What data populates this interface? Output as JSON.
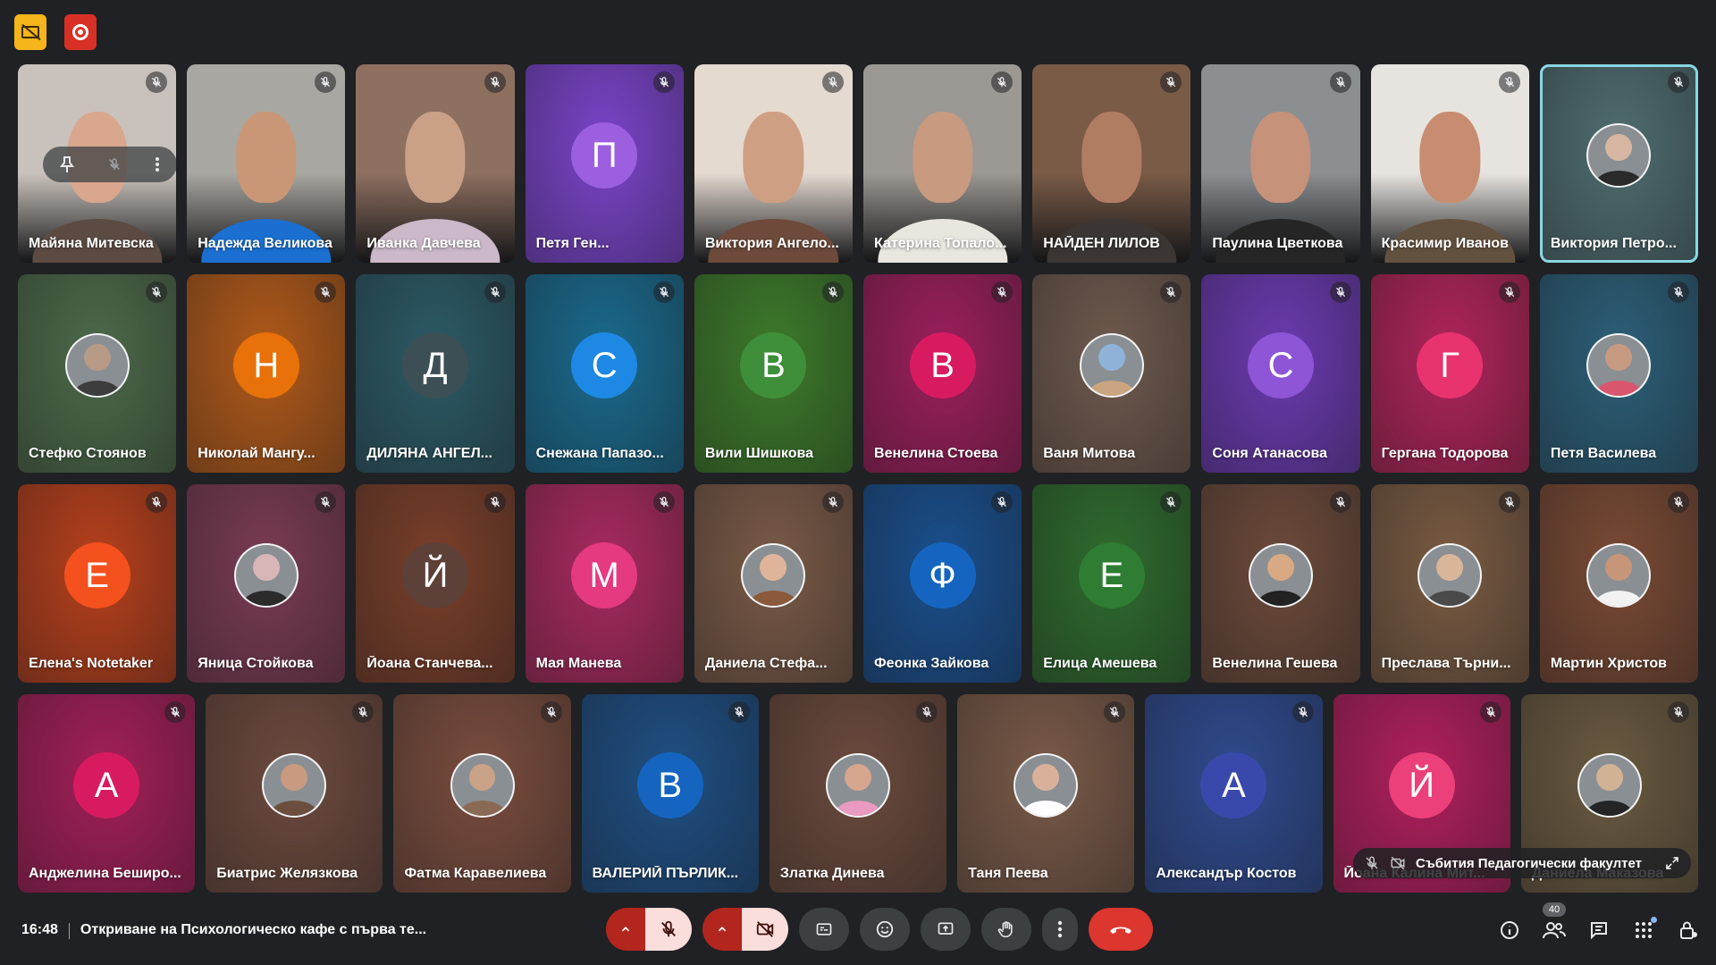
{
  "rows": [
    {
      "tiles": [
        {
          "name": "Майяна Митевска",
          "type": "video",
          "bg": "#c9c2bc",
          "skin": "#d9a78e",
          "shirt": "#5c4b43",
          "controls": true
        },
        {
          "name": "Надежда Великова",
          "type": "video",
          "bg": "#a9a7a1",
          "skin": "#c99676",
          "shirt": "#1b6fd0"
        },
        {
          "name": "Иванка Давчева",
          "type": "video",
          "bg": "#8e7060",
          "skin": "#caa187",
          "shirt": "#cbb9c9"
        },
        {
          "name": "Петя Ген...",
          "type": "letter",
          "letter": "П",
          "bg": "#7a44c9",
          "avatar": "#9c5fe0"
        },
        {
          "name": "Виктория Ангело...",
          "type": "video",
          "bg": "#e4dad0",
          "skin": "#cf9f84",
          "shirt": "#6d4a3a"
        },
        {
          "name": "Катерина Топало...",
          "type": "video",
          "bg": "#9c9893",
          "skin": "#c89a80",
          "shirt": "#e9e5df"
        },
        {
          "name": "НАЙДЕН ЛИЛОВ",
          "type": "video",
          "bg": "#7a5b46",
          "skin": "#b07d63",
          "shirt": "#3b3633"
        },
        {
          "name": "Паулина Цветкова",
          "type": "video",
          "bg": "#8b8f92",
          "skin": "#c69279",
          "shirt": "#252525"
        },
        {
          "name": "Красимир Иванов",
          "type": "video",
          "bg": "#e7e4df",
          "skin": "#c88d70",
          "shirt": "#63513f"
        },
        {
          "name": "Виктория Петро...",
          "type": "photo",
          "bg": "#4f6d70",
          "skin": "#d7b6a2",
          "shirt": "#2a2a2a",
          "speaking": true
        }
      ]
    },
    {
      "tiles": [
        {
          "name": "Стефко Стоянов",
          "type": "photo",
          "bg": "#4d6a4a",
          "skin": "#b79b86",
          "shirt": "#3d3d3d"
        },
        {
          "name": "Николай Мангу...",
          "type": "letter",
          "letter": "Н",
          "bg": "#b15a1a",
          "avatar": "#e8710a"
        },
        {
          "name": "ДИЛЯНА АНГЕЛ...",
          "type": "letter",
          "letter": "Д",
          "bg": "#2c5a66",
          "avatar": "#3c4f55"
        },
        {
          "name": "Снежана Папазо...",
          "type": "letter",
          "letter": "С",
          "bg": "#1a6a8d",
          "avatar": "#1e88e5"
        },
        {
          "name": "Вили Шишкова",
          "type": "letter",
          "letter": "В",
          "bg": "#3d7a2a",
          "avatar": "#3f8f3a"
        },
        {
          "name": "Венелина Стоева",
          "type": "letter",
          "letter": "В",
          "bg": "#9c1f5c",
          "avatar": "#d81b60"
        },
        {
          "name": "Ваня Митова",
          "type": "photo",
          "bg": "#6f5a4e",
          "skin": "#8fb3d8",
          "shirt": "#caa580"
        },
        {
          "name": "Соня Атанасова",
          "type": "letter",
          "letter": "С",
          "bg": "#6b3ab0",
          "avatar": "#8e55d6"
        },
        {
          "name": "Гергана Тодорова",
          "type": "letter",
          "letter": "Г",
          "bg": "#b0245a",
          "avatar": "#e8336f"
        },
        {
          "name": "Петя Василева",
          "type": "photo",
          "bg": "#2c5f78",
          "skin": "#c79a82",
          "shirt": "#d9566e"
        }
      ]
    },
    {
      "tiles": [
        {
          "name": "Елена's Notetaker",
          "type": "letter",
          "letter": "Е",
          "bg": "#b7401c",
          "avatar": "#f4511e"
        },
        {
          "name": "Яница Стойкова",
          "type": "photo",
          "bg": "#7a3b54",
          "skin": "#d8b6b8",
          "shirt": "#2b2b2b"
        },
        {
          "name": "Йоана Станчева...",
          "type": "letter",
          "letter": "Й",
          "bg": "#7a3f2a",
          "avatar": "#5d4037"
        },
        {
          "name": "Мая Манева",
          "type": "letter",
          "letter": "М",
          "bg": "#a82a5e",
          "avatar": "#e53980"
        },
        {
          "name": "Даниела Стефа...",
          "type": "photo",
          "bg": "#7a5a47",
          "skin": "#e0b49a",
          "shirt": "#8a5a3b"
        },
        {
          "name": "Феонка Зайкова",
          "type": "letter",
          "letter": "Ф",
          "bg": "#1a4f8d",
          "avatar": "#1565c0"
        },
        {
          "name": "Елица Амешева",
          "type": "letter",
          "letter": "Е",
          "bg": "#2f6b2e",
          "avatar": "#2e7d32"
        },
        {
          "name": "Венелина Гешева",
          "type": "photo",
          "bg": "#6c4a3a",
          "skin": "#d8a983",
          "shirt": "#222222"
        },
        {
          "name": "Преслава Търни...",
          "type": "photo",
          "bg": "#7a5b42",
          "skin": "#d9b59a",
          "shirt": "#4a4a4a"
        },
        {
          "name": "Мартин Христов",
          "type": "photo",
          "bg": "#7a4a34",
          "skin": "#c79577",
          "shirt": "#f2f2f2"
        }
      ]
    },
    {
      "tiles": [
        {
          "name": "Анджелина Беширо...",
          "type": "letter",
          "letter": "А",
          "bg": "#a31f58",
          "avatar": "#d81b60"
        },
        {
          "name": "Биатрис Желязкова",
          "type": "photo",
          "bg": "#6d4a3e",
          "skin": "#c99a80",
          "shirt": "#6b4e3d"
        },
        {
          "name": "Фатма Каравелиева",
          "type": "photo",
          "bg": "#7a4d3e",
          "skin": "#caa287",
          "shirt": "#8a6a55"
        },
        {
          "name": "ВАЛЕРИЙ ПЪРЛИК...",
          "type": "letter",
          "letter": "В",
          "bg": "#1f4f83",
          "avatar": "#1565c0"
        },
        {
          "name": "Златка Динева",
          "type": "photo",
          "bg": "#6b4a3d",
          "skin": "#d6a68e",
          "shirt": "#e89ac0"
        },
        {
          "name": "Таня Пеева",
          "type": "photo",
          "bg": "#7a5a48",
          "skin": "#d9b19a",
          "shirt": "#ffffff"
        },
        {
          "name": "Александър Костов",
          "type": "letter",
          "letter": "А",
          "bg": "#2f4b8f",
          "avatar": "#3949ab"
        },
        {
          "name": "Йоана Калина Мит...",
          "type": "letter",
          "letter": "Й",
          "bg": "#b11f5d",
          "avatar": "#ec407a"
        },
        {
          "name": "Даниела Маказова",
          "type": "photo",
          "bg": "#6a5a40",
          "skin": "#d1b295",
          "shirt": "#242424",
          "pinned": true
        }
      ]
    }
  ],
  "pin_toast": {
    "label": "Събития Педагогически факултет"
  },
  "bottombar": {
    "time": "16:48",
    "meeting_title": "Откриване на Психологическо кафе с първа те...",
    "participant_count": "40"
  },
  "colors": {
    "background": "#202124",
    "control_bg": "#3c4043",
    "hangup": "#dc362e",
    "mic_off_accent": "#b3261e",
    "speaking_outline": "#8ad6e3"
  }
}
